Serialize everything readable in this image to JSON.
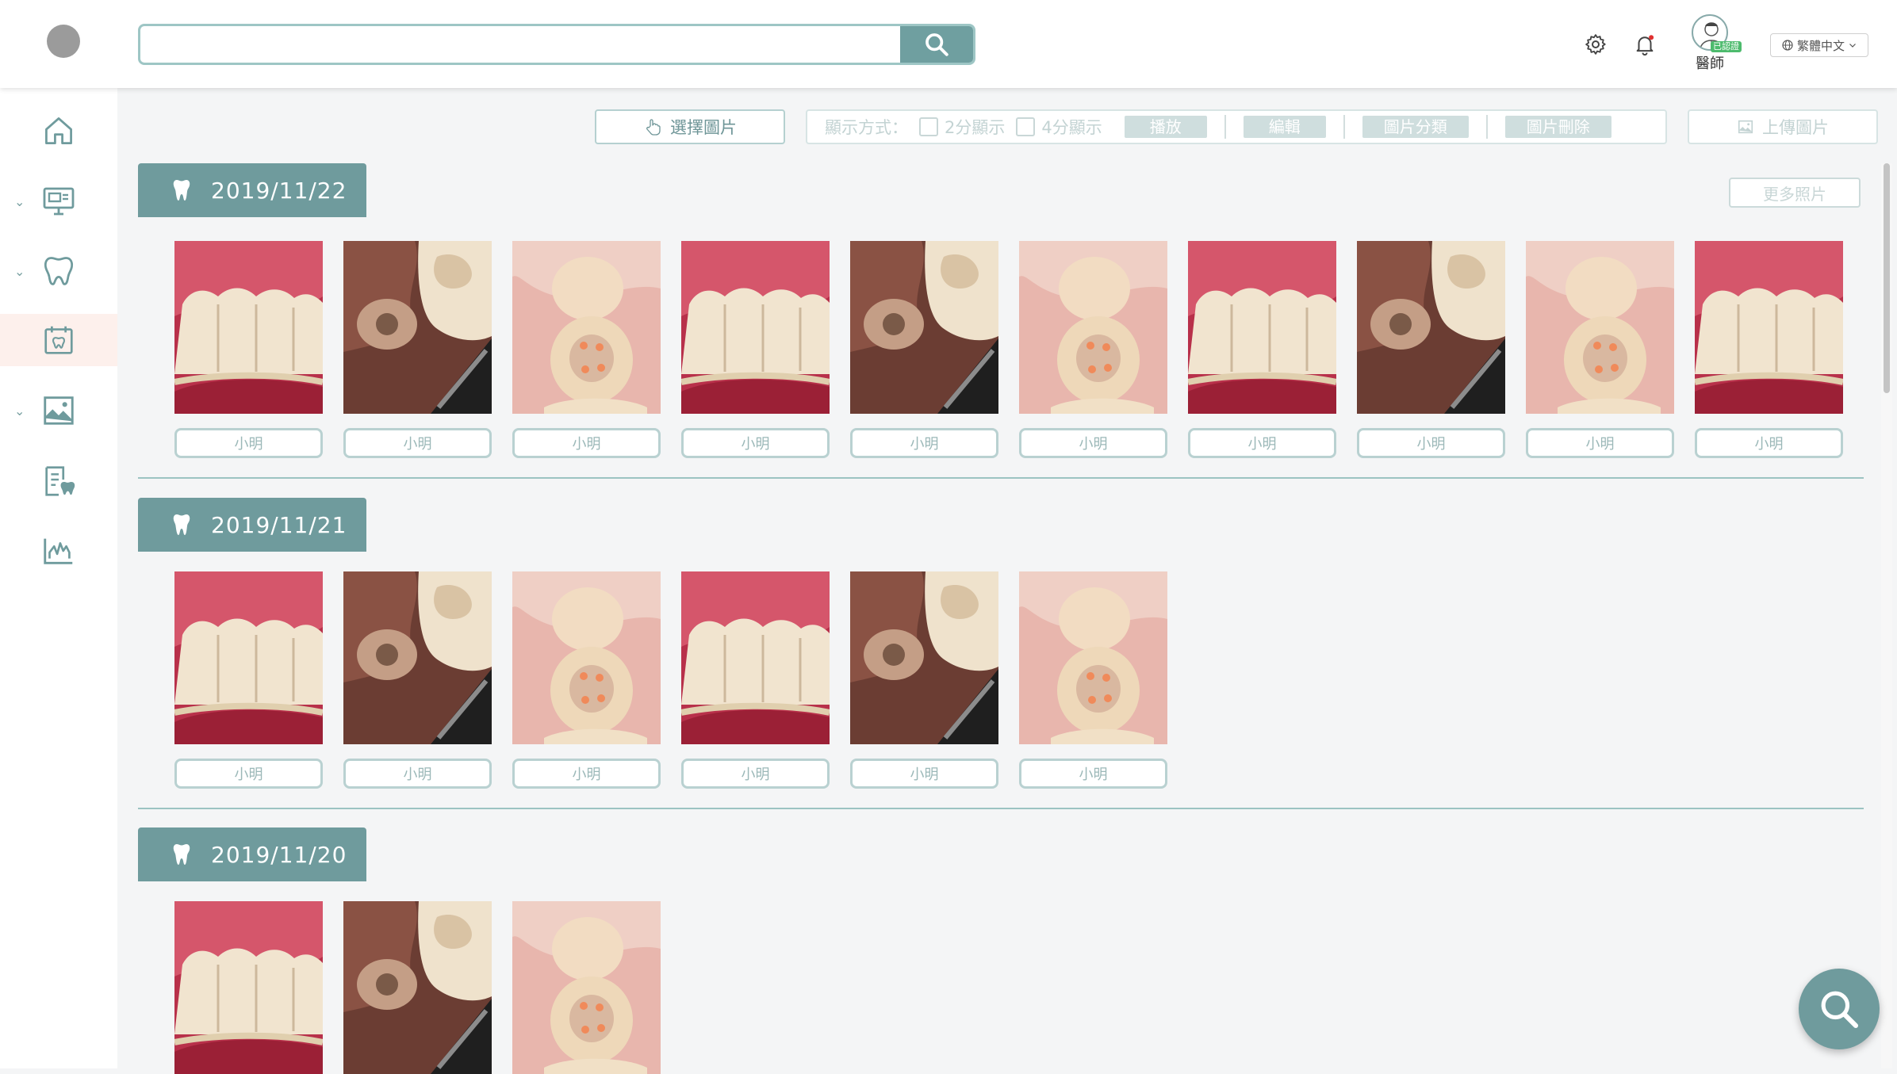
{
  "header": {
    "search_placeholder": "",
    "doctor_label": "醫師",
    "verified_badge": "已認證",
    "language": "繁體中文"
  },
  "toolbar": {
    "select_images_label": "選擇圖片",
    "view_mode_label": "顯示方式：",
    "view_2_label": "2分顯示",
    "view_4_label": "4分顯示",
    "play_label": "播放",
    "edit_label": "編輯",
    "classify_label": "圖片分類",
    "delete_label": "圖片刪除",
    "upload_label": "上傳圖片",
    "more_photos_label": "更多照片"
  },
  "sections": [
    {
      "date": "2019/11/22",
      "photos": [
        "小明",
        "小明",
        "小明",
        "小明",
        "小明",
        "小明",
        "小明",
        "小明",
        "小明",
        "小明"
      ]
    },
    {
      "date": "2019/11/21",
      "photos": [
        "小明",
        "小明",
        "小明",
        "小明",
        "小明",
        "小明"
      ]
    },
    {
      "date": "2019/11/20",
      "photos": [
        "",
        "",
        ""
      ]
    }
  ],
  "sidebar": {
    "items": [
      "home-icon",
      "monitor-icon",
      "tooth-icon",
      "calendar-tooth-icon",
      "image-icon",
      "records-icon",
      "chart-icon"
    ]
  },
  "colors": {
    "accent": "#6f9b9d",
    "border": "#9ec6c5",
    "active_bg": "#fdf0ec"
  }
}
